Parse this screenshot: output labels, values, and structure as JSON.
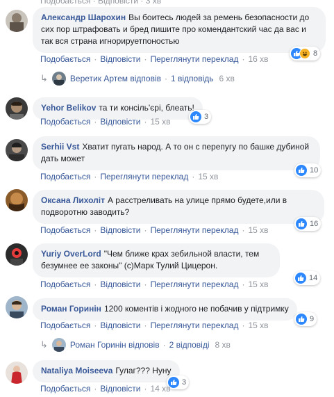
{
  "top_strip": "Подобається · Відповісти · 3 хв",
  "actions": {
    "like": "Подобається",
    "reply": "Відповісти",
    "see_translation": "Переглянути переклад"
  },
  "comments": [
    {
      "author": "Александр Шарохин",
      "text": "Вы боитесь людей за ремень безопасности до сих пор штрафовать и бред пишите про комендантский час да вас и так вся страна игнорируетпоностью",
      "reactions": "8",
      "time": "16 хв",
      "reply_summary": {
        "replier": "Веретик Артем відповів",
        "count": "1 відповідь",
        "time": "6 хв"
      }
    },
    {
      "author": "Yehor Belikov",
      "text": "та ти консіль'єрі, блеать!",
      "reactions": "3",
      "time": "15 хв"
    },
    {
      "author": "Serhii Vst",
      "text": "Хватит пугать народ. А то он с перепугу по башке дубиной дать может",
      "reactions": "10",
      "time": "15 хв"
    },
    {
      "author": "Оксана Лихоліт",
      "text": "А расстреливать на улице прямо будете,или в подворотню заводить?",
      "reactions": "16",
      "time": "15 хв"
    },
    {
      "author": "Yuriy OverLord",
      "text": "\"Чем ближе крах зебильной власти, тем безумнее ее законы\" (с)Марк Тулий Цицерон.",
      "reactions": "14",
      "time": "15 хв"
    },
    {
      "author": "Роман Горинін",
      "text": "1200 коментів і жодного не побачив у підтримку",
      "reactions": "9",
      "time": "15 хв",
      "reply_summary": {
        "replier": "Роман Горинін відповів",
        "count": "2 відповіді",
        "time": "8 хв"
      }
    },
    {
      "author": "Nataliya Moiseeva",
      "text": "Гулаг??? Нуну",
      "reactions": "3",
      "time": "14 хв"
    }
  ],
  "colors": {
    "link": "#385898",
    "bubble": "#f2f3f5",
    "meta": "#90949c",
    "like": "#2d88ff",
    "haha": "#f7b125"
  }
}
